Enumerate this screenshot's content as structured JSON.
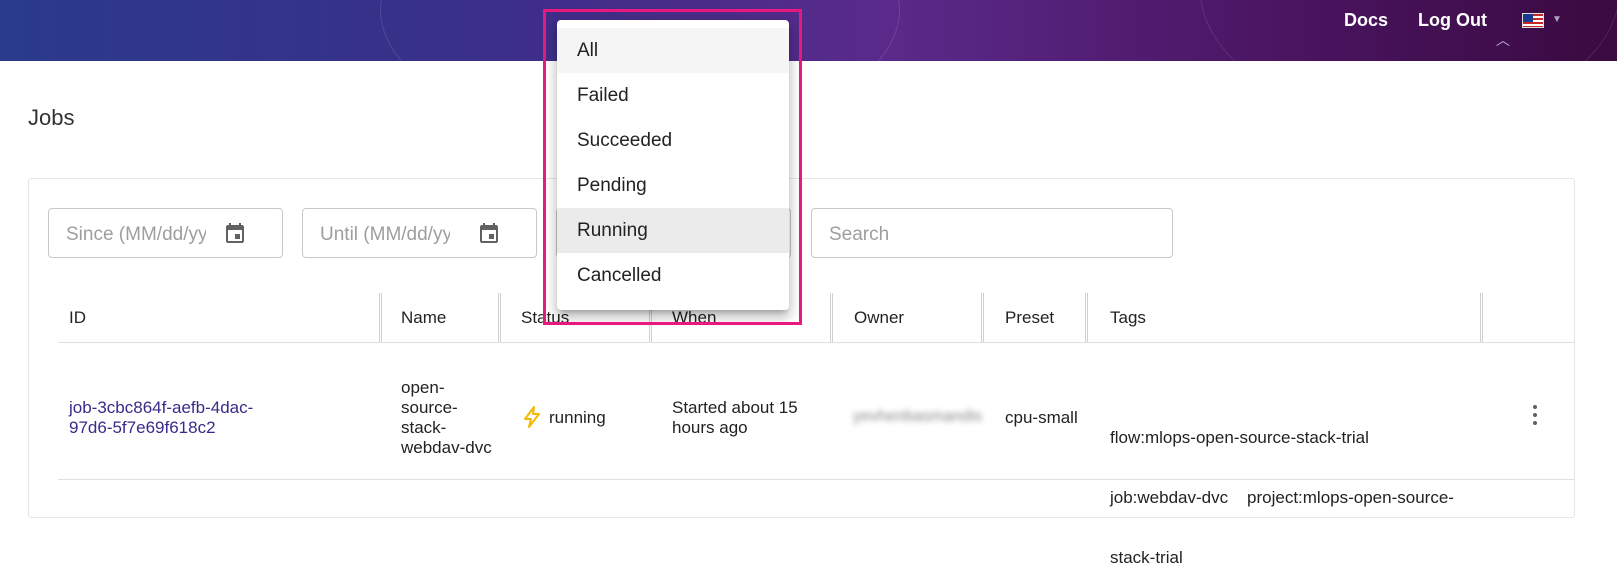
{
  "header": {
    "docs": "Docs",
    "logout": "Log Out",
    "locale_icon": "us-flag-icon"
  },
  "page": {
    "title": "Jobs"
  },
  "filters": {
    "since_placeholder": "Since (MM/dd/yyyy)",
    "until_placeholder": "Until (MM/dd/yyyy)",
    "search_placeholder": "Search"
  },
  "status_menu": {
    "options": [
      "All",
      "Failed",
      "Succeeded",
      "Pending",
      "Running",
      "Cancelled"
    ],
    "hovered": "Running"
  },
  "table": {
    "columns": [
      "ID",
      "Name",
      "Status",
      "When",
      "Owner",
      "Preset",
      "Tags"
    ],
    "rows": [
      {
        "id_line1": "job-3cbc864f-aefb-4dac-",
        "id_line2": "97d6-5f7e69f618c2",
        "name_lines": [
          "open-",
          "source-",
          "stack-",
          "webdav-dvc"
        ],
        "status": "running",
        "status_icon": "lightning-icon",
        "when_line1": "Started about 15",
        "when_line2": "hours ago",
        "owner": "yevhenbasmandis",
        "preset": "cpu-small",
        "tags_line1": "flow:mlops-open-source-stack-trial",
        "tags_line2": "job:webdav-dvc    project:mlops-open-source-",
        "tags_line3": "stack-trial"
      }
    ]
  },
  "colors": {
    "accent": "#3a2a8a",
    "highlight": "#e8197d",
    "status_icon": "#f5b800"
  }
}
